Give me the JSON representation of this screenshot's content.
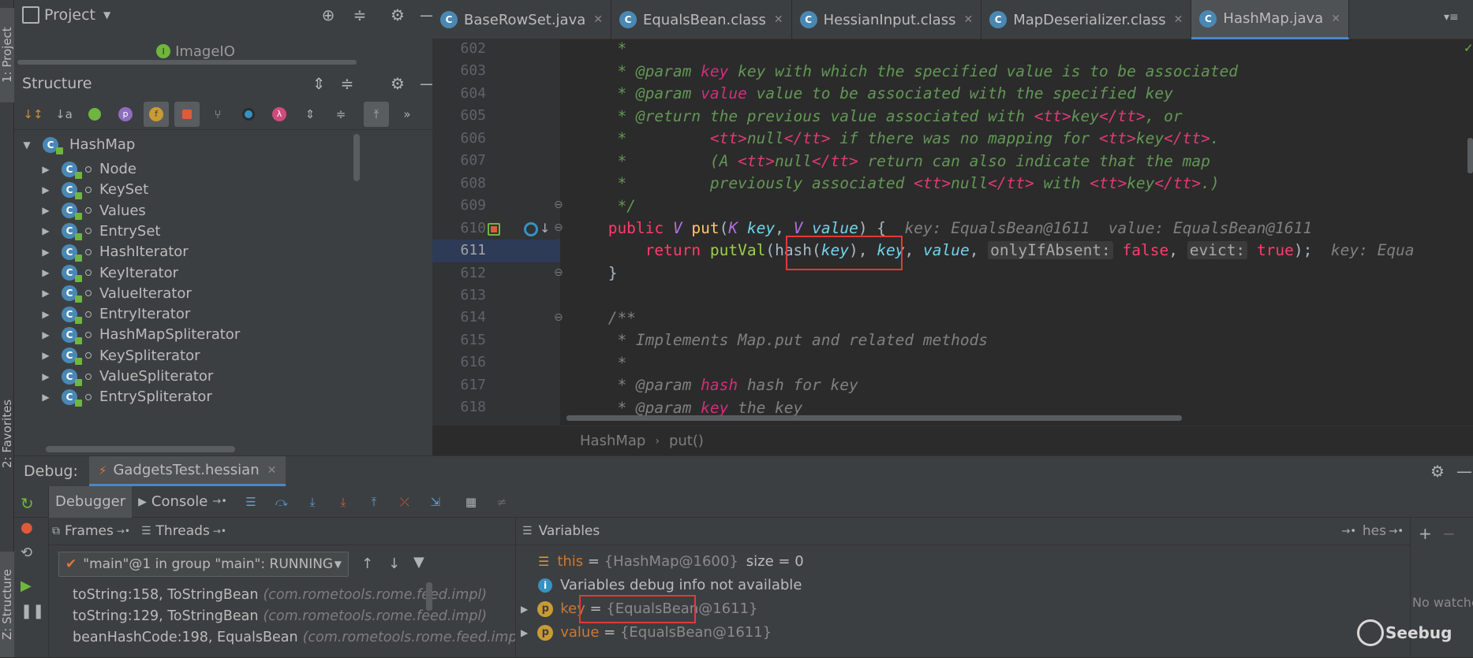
{
  "left_strip": {
    "project_tab": "1: Project",
    "favorites_tab": "2: Favorites",
    "structure_tab": "Z: Structure"
  },
  "project_panel": {
    "title": "Project",
    "node": "ImageIO"
  },
  "structure_panel": {
    "title": "Structure",
    "root": "HashMap",
    "items": [
      "Node",
      "KeySet",
      "Values",
      "EntrySet",
      "HashIterator",
      "KeyIterator",
      "ValueIterator",
      "EntryIterator",
      "HashMapSpliterator",
      "KeySpliterator",
      "ValueSpliterator",
      "EntrySpliterator"
    ]
  },
  "editor_tabs": [
    {
      "label": "BaseRowSet.java",
      "active": false
    },
    {
      "label": "EqualsBean.class",
      "active": false
    },
    {
      "label": "HessianInput.class",
      "active": false
    },
    {
      "label": "MapDeserializer.class",
      "active": false
    },
    {
      "label": "HashMap.java",
      "active": true
    }
  ],
  "code": {
    "line_numbers": [
      "602",
      "603",
      "604",
      "605",
      "606",
      "607",
      "608",
      "609",
      "610",
      "611",
      "612",
      "613",
      "614",
      "615",
      "616",
      "617",
      "618"
    ],
    "put_hint": "key: EqualsBean@1611  value: EqualsBean@1611",
    "return_hint": "key: Equa",
    "hint_onlyIfAbsent": "onlyIfAbsent:",
    "hint_evict": "evict:"
  },
  "breadcrumbs": {
    "class": "HashMap",
    "method": "put()"
  },
  "debug": {
    "title": "Debug:",
    "session": "GadgetsTest.hessian",
    "tab_debugger": "Debugger",
    "tab_console": "Console",
    "frames_label": "Frames",
    "threads_label": "Threads",
    "thread_select": "\"main\"@1 in group \"main\": RUNNING",
    "frames": [
      {
        "method": "toString:158, ToStringBean",
        "pkg": "(com.rometools.rome.feed.impl)"
      },
      {
        "method": "toString:129, ToStringBean",
        "pkg": "(com.rometools.rome.feed.impl)"
      },
      {
        "method": "beanHashCode:198, EqualsBean",
        "pkg": "(com.rometools.rome.feed.impl)"
      }
    ],
    "variables_label": "Variables",
    "variables_right": "hes",
    "vars": {
      "this_name": "this",
      "this_eq": " = ",
      "this_val": "{HashMap@1600}",
      "this_size": "size = 0",
      "info": "Variables debug info not available",
      "key_name": "key",
      "key_eq": " = ",
      "key_val": "{EqualsBean@1611}",
      "value_name": "value",
      "value_eq": " = ",
      "value_val": "{EqualsBean@1611}"
    },
    "watches_text": "No watche"
  },
  "watermark": "Seebug"
}
